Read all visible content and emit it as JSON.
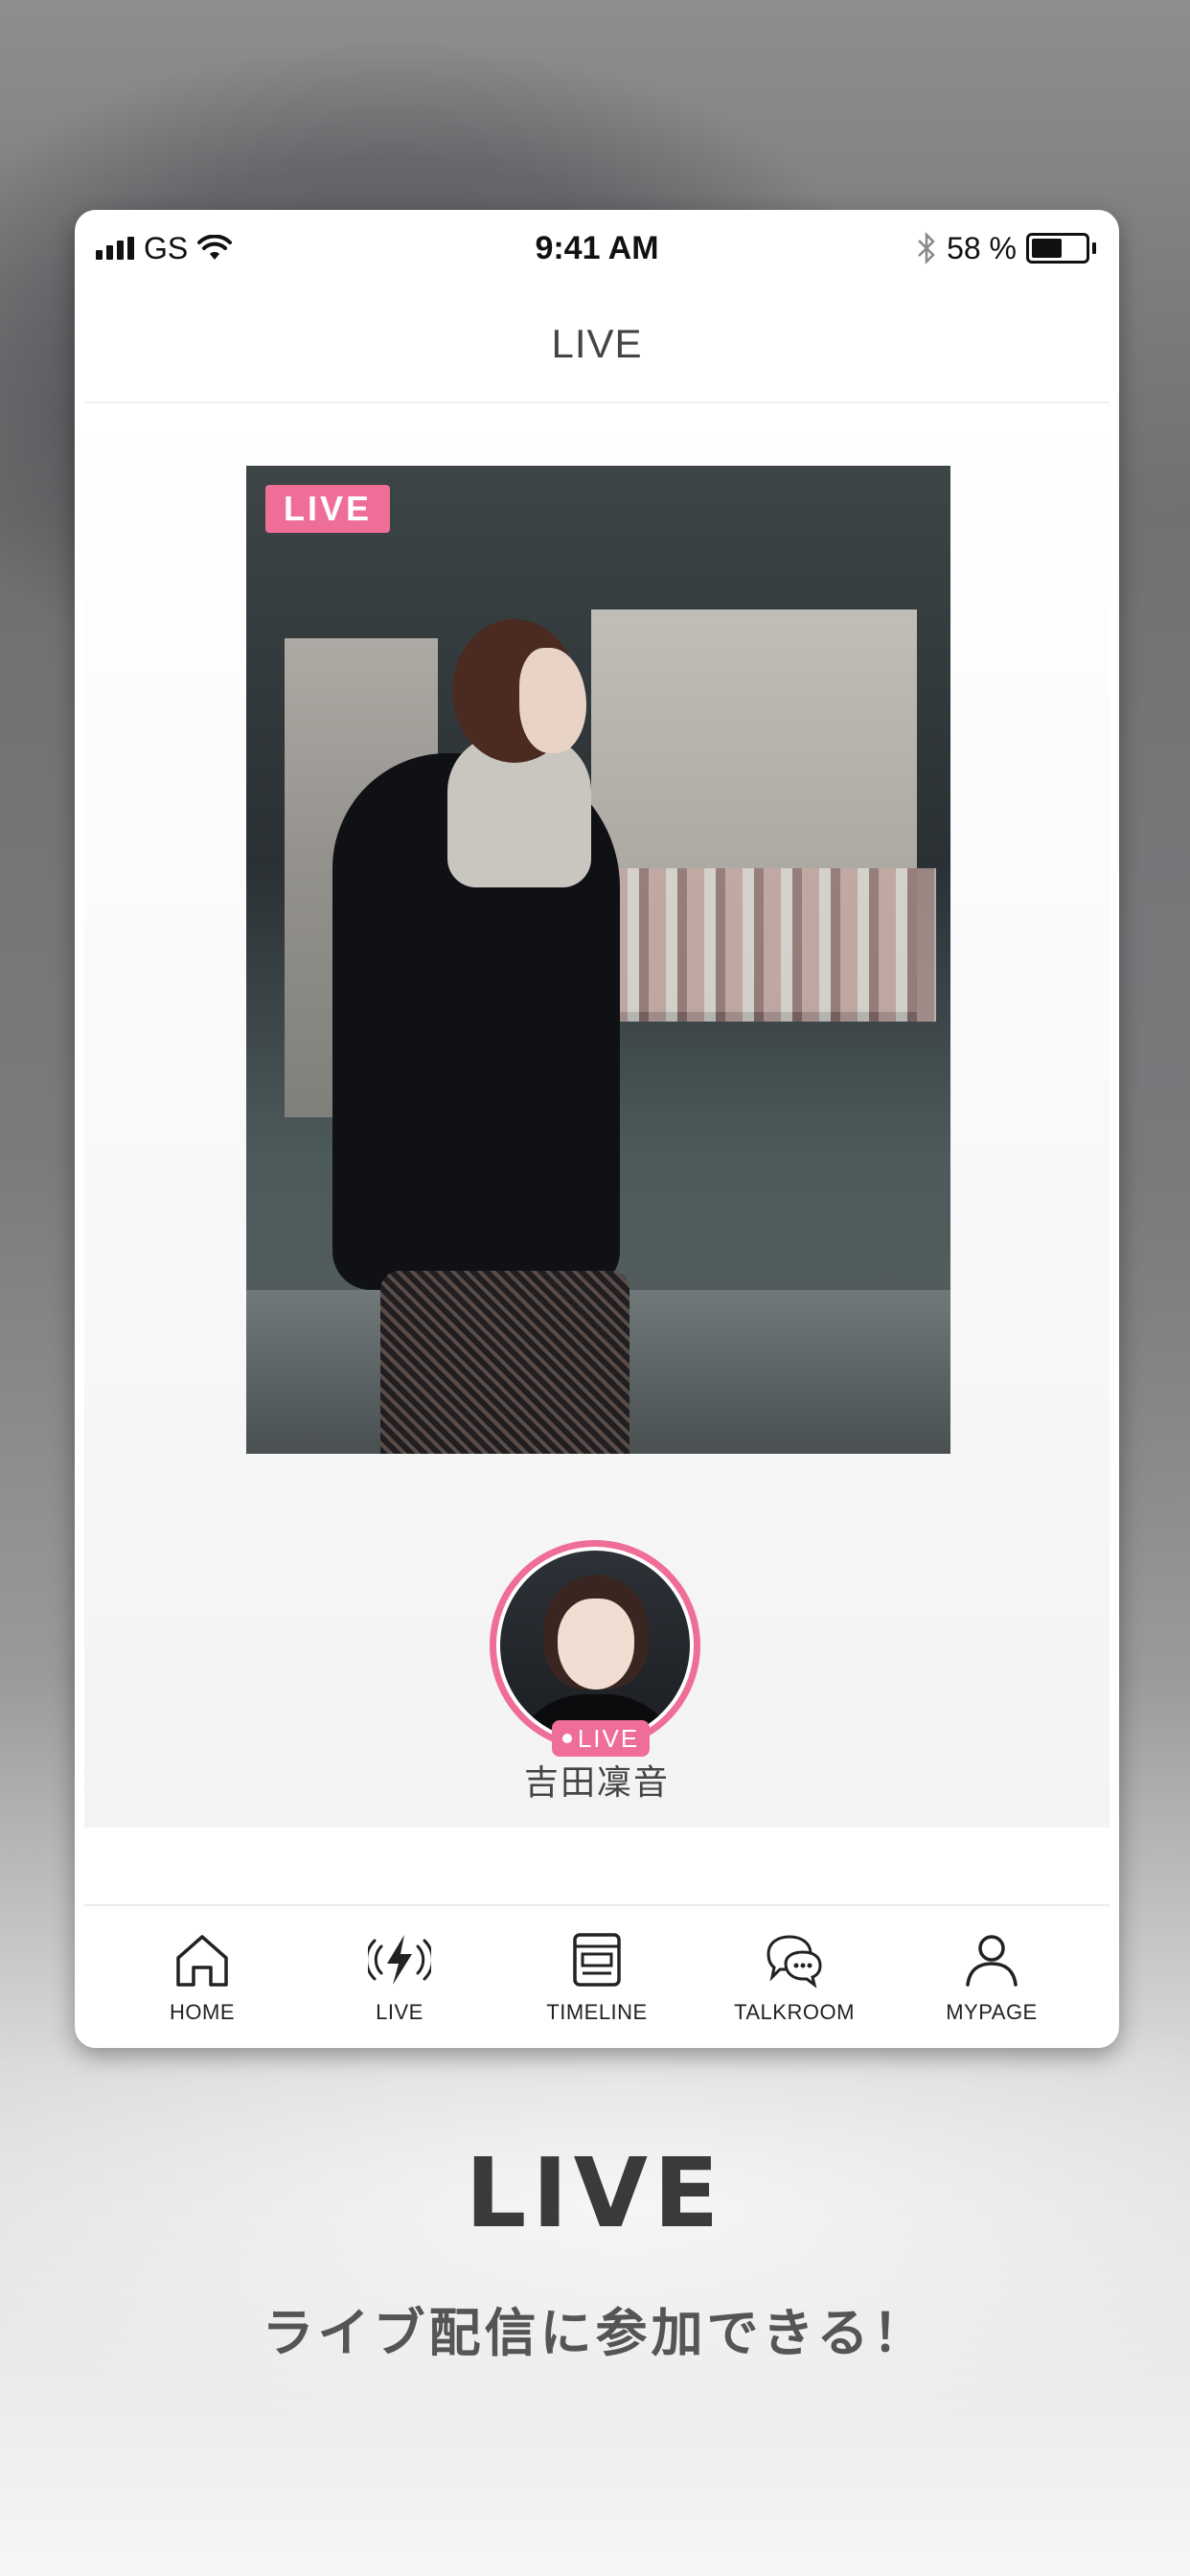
{
  "status_bar": {
    "carrier": "GS",
    "time": "9:41 AM",
    "battery_percent_text": "58 %",
    "battery_level": 0.58
  },
  "header": {
    "title": "LIVE"
  },
  "featured_stream": {
    "badge": "LIVE",
    "avatar_badge": "LIVE",
    "streamer_name": "吉田凜音"
  },
  "videos": [
    {
      "type": "video",
      "play_icon": "play-icon"
    },
    {
      "type": "video",
      "play_icon": "play-icon"
    }
  ],
  "tab_bar": {
    "items": [
      {
        "label": "HOME",
        "icon": "home-icon"
      },
      {
        "label": "LIVE",
        "icon": "live-bolt-icon"
      },
      {
        "label": "TIMELINE",
        "icon": "timeline-icon"
      },
      {
        "label": "TALKROOM",
        "icon": "chat-bubbles-icon"
      },
      {
        "label": "MYPAGE",
        "icon": "person-icon"
      }
    ]
  },
  "promo": {
    "title": "LIVE",
    "subtitle": "ライブ配信に参加できる！"
  },
  "colors": {
    "accent_pink": "#ef6e98",
    "text_dark": "#444444"
  }
}
